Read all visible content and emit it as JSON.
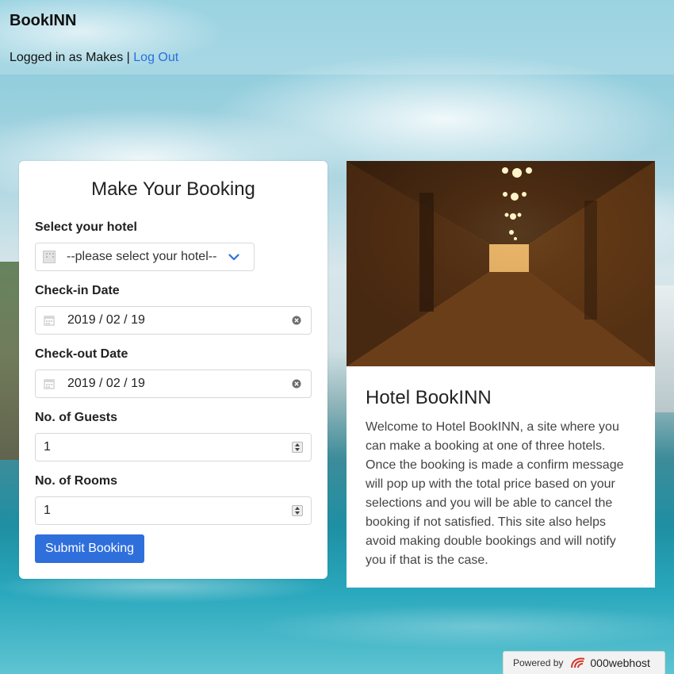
{
  "header": {
    "brand": "BookINN",
    "login_prefix": "Logged in as Makes |",
    "logout_label": "Log Out"
  },
  "booking": {
    "title": "Make Your Booking",
    "hotel_label": "Select your hotel",
    "hotel_selected": "--please select your hotel--",
    "checkin_label": "Check-in Date",
    "checkin_value": "2019 / 02 / 19",
    "checkout_label": "Check-out Date",
    "checkout_value": "2019 / 02 / 19",
    "guests_label": "No. of Guests",
    "guests_value": "1",
    "rooms_label": "No. of Rooms",
    "rooms_value": "1",
    "submit_label": "Submit Booking"
  },
  "info": {
    "title": "Hotel BookINN",
    "text": "Welcome to Hotel BookINN, a site where you can make a booking at one of three hotels. Once the booking is made a confirm message will pop up with the total price based on your selections and you will be able to cancel the booking if not satisfied. This site also helps avoid making double bookings and will notify you if that is the case."
  },
  "footer": {
    "powered_by": "Powered by",
    "host": "000webhost"
  },
  "colors": {
    "accent": "#2f6fdc",
    "link": "#2a6fdb"
  },
  "icons": [
    "hotel-icon",
    "chevron-down-icon",
    "calendar-icon",
    "clear-icon",
    "spinner-icon",
    "webhost-logo-icon"
  ]
}
